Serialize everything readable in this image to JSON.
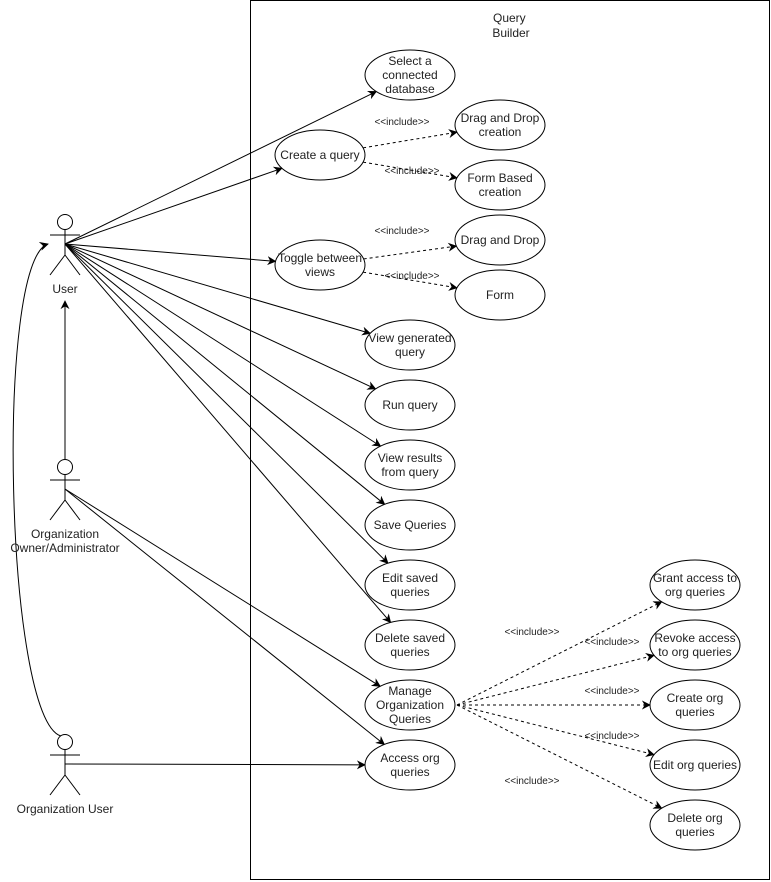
{
  "system": {
    "title_lines": [
      "Query",
      "Builder"
    ]
  },
  "actors": [
    {
      "id": "user",
      "label_lines": [
        "User"
      ]
    },
    {
      "id": "org_admin",
      "label_lines": [
        "Organization",
        "Owner/Administrator"
      ]
    },
    {
      "id": "org_user",
      "label_lines": [
        "Organization User"
      ]
    }
  ],
  "use_cases": [
    {
      "id": "select_db",
      "label_lines": [
        "Select a",
        "connected",
        "database"
      ]
    },
    {
      "id": "create_query",
      "label_lines": [
        "Create a query"
      ]
    },
    {
      "id": "dnd_creation",
      "label_lines": [
        "Drag and Drop",
        "creation"
      ]
    },
    {
      "id": "form_creation",
      "label_lines": [
        "Form Based",
        "creation"
      ]
    },
    {
      "id": "toggle_views",
      "label_lines": [
        "Toggle between",
        "views"
      ]
    },
    {
      "id": "dnd",
      "label_lines": [
        "Drag and Drop"
      ]
    },
    {
      "id": "form",
      "label_lines": [
        "Form"
      ]
    },
    {
      "id": "view_generated",
      "label_lines": [
        "View generated",
        "query"
      ]
    },
    {
      "id": "run_query",
      "label_lines": [
        "Run query"
      ]
    },
    {
      "id": "view_results",
      "label_lines": [
        "View results",
        "from query"
      ]
    },
    {
      "id": "save_queries",
      "label_lines": [
        "Save Queries"
      ]
    },
    {
      "id": "edit_saved",
      "label_lines": [
        "Edit saved",
        "queries"
      ]
    },
    {
      "id": "delete_saved",
      "label_lines": [
        "Delete saved",
        "queries"
      ]
    },
    {
      "id": "manage_org",
      "label_lines": [
        "Manage",
        "Organization",
        "Queries"
      ]
    },
    {
      "id": "access_org",
      "label_lines": [
        "Access org",
        "queries"
      ]
    },
    {
      "id": "grant_access",
      "label_lines": [
        "Grant access to",
        "org queries"
      ]
    },
    {
      "id": "revoke_access",
      "label_lines": [
        "Revoke access",
        "to org queries"
      ]
    },
    {
      "id": "create_org",
      "label_lines": [
        "Create org",
        "queries"
      ]
    },
    {
      "id": "edit_org",
      "label_lines": [
        "Edit org queries"
      ]
    },
    {
      "id": "delete_org",
      "label_lines": [
        "Delete org",
        "queries"
      ]
    }
  ],
  "associations": [
    {
      "from": "user",
      "to": "select_db"
    },
    {
      "from": "user",
      "to": "create_query"
    },
    {
      "from": "user",
      "to": "toggle_views"
    },
    {
      "from": "user",
      "to": "view_generated"
    },
    {
      "from": "user",
      "to": "run_query"
    },
    {
      "from": "user",
      "to": "view_results"
    },
    {
      "from": "user",
      "to": "save_queries"
    },
    {
      "from": "user",
      "to": "edit_saved"
    },
    {
      "from": "user",
      "to": "delete_saved"
    },
    {
      "from": "org_admin",
      "to": "manage_org"
    },
    {
      "from": "org_admin",
      "to": "access_org"
    },
    {
      "from": "org_user",
      "to": "access_org"
    }
  ],
  "includes": [
    {
      "from": "create_query",
      "to": "dnd_creation",
      "label": "<<include>>"
    },
    {
      "from": "create_query",
      "to": "form_creation",
      "label": "<<include>>"
    },
    {
      "from": "toggle_views",
      "to": "dnd",
      "label": "<<include>>"
    },
    {
      "from": "toggle_views",
      "to": "form",
      "label": "<<include>>"
    },
    {
      "from": "manage_org",
      "to": "grant_access",
      "label": "<<include>>"
    },
    {
      "from": "manage_org",
      "to": "revoke_access",
      "label": "<<include>>"
    },
    {
      "from": "manage_org",
      "to": "create_org",
      "label": "<<include>>"
    },
    {
      "from": "manage_org",
      "to": "edit_org",
      "label": "<<include>>"
    },
    {
      "from": "manage_org",
      "to": "delete_org",
      "label": "<<include>>"
    }
  ],
  "generalizations": [
    {
      "from": "org_admin",
      "to": "user"
    },
    {
      "from": "org_user",
      "to": "user"
    }
  ]
}
